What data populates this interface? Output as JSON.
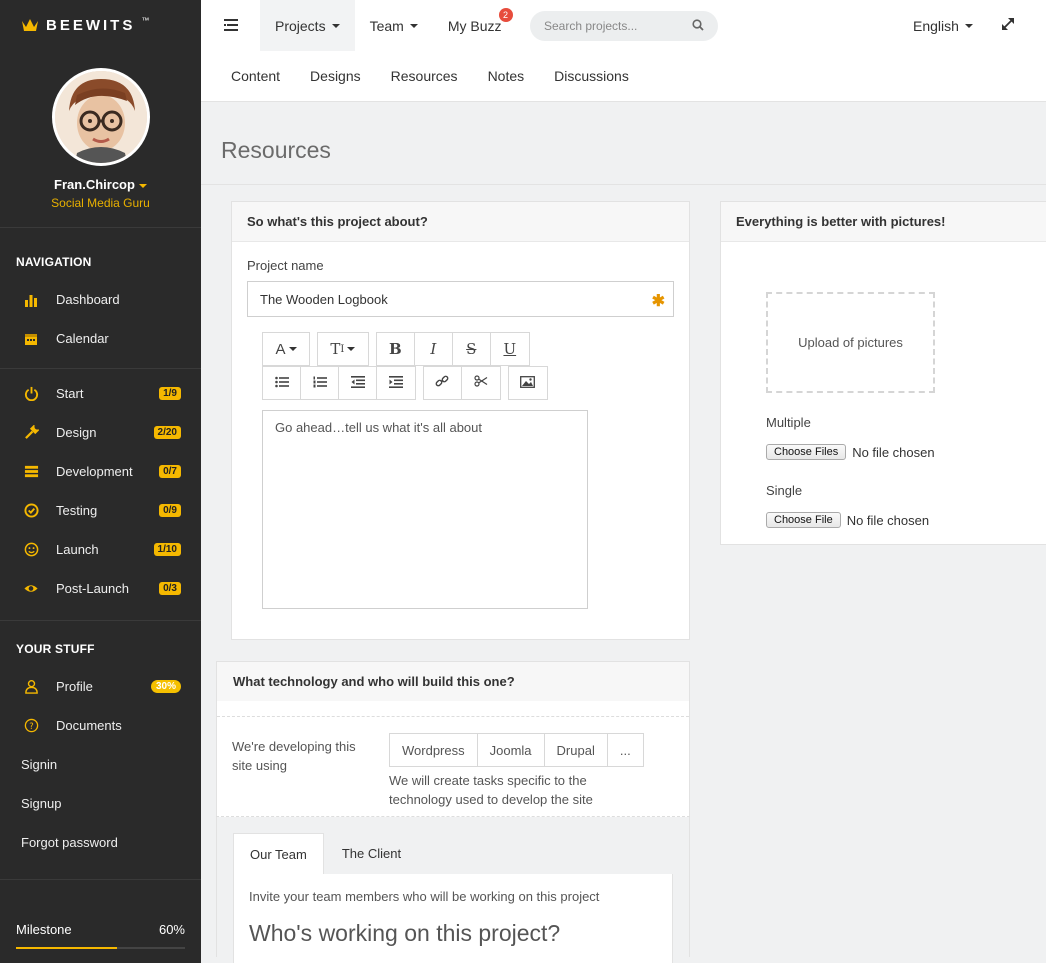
{
  "brand": {
    "name": "BEEWITS",
    "tm": "™",
    "accent": "#f5b800"
  },
  "user": {
    "name": "Fran.Chircop",
    "role": "Social Media Guru"
  },
  "nav": {
    "heading": "NAVIGATION",
    "items": [
      {
        "label": "Dashboard",
        "icon": "bar-chart-icon"
      },
      {
        "label": "Calendar",
        "icon": "calendar-icon"
      }
    ]
  },
  "phases": [
    {
      "label": "Start",
      "badge": "1/9",
      "icon": "power-icon"
    },
    {
      "label": "Design",
      "badge": "2/20",
      "icon": "wrench-icon"
    },
    {
      "label": "Development",
      "badge": "0/7",
      "icon": "server-icon"
    },
    {
      "label": "Testing",
      "badge": "0/9",
      "icon": "check-circle-icon"
    },
    {
      "label": "Launch",
      "badge": "1/10",
      "icon": "smile-icon"
    },
    {
      "label": "Post-Launch",
      "badge": "0/3",
      "icon": "eye-icon"
    }
  ],
  "your_stuff": {
    "heading": "YOUR STUFF",
    "items": [
      {
        "label": "Profile",
        "badge": "30%",
        "icon": "user-icon"
      },
      {
        "label": "Documents",
        "icon": "help-circle-icon"
      },
      {
        "label": "Signin"
      },
      {
        "label": "Signup"
      },
      {
        "label": "Forgot password"
      }
    ]
  },
  "milestone": {
    "label": "Milestone",
    "value": "60%",
    "progress": 0.6
  },
  "header": {
    "tabs": [
      {
        "label": "Projects",
        "dropdown": true,
        "active": true
      },
      {
        "label": "Team",
        "dropdown": true
      },
      {
        "label": "My Buzz",
        "notifications": "2"
      }
    ],
    "search_placeholder": "Search projects...",
    "language": "English",
    "subtabs": [
      "Content",
      "Designs",
      "Resources",
      "Notes",
      "Discussions"
    ]
  },
  "page": {
    "title": "Resources"
  },
  "project_panel": {
    "title": "So what's this project about?",
    "name_label": "Project name",
    "name_value": "The Wooden Logbook",
    "editor_text": "Go ahead…tell us what it's all about"
  },
  "pictures_panel": {
    "title": "Everything is better with pictures!",
    "upload_text": "Upload of pictures",
    "multiple_label": "Multiple",
    "multiple_button": "Choose Files",
    "multiple_status": "No file chosen",
    "single_label": "Single",
    "single_button": "Choose File",
    "single_status": "No file chosen"
  },
  "tech_panel": {
    "title": "What technology and who will build this one?",
    "developing_label": "We're developing this site using",
    "options": [
      "Wordpress",
      "Joomla",
      "Drupal",
      "..."
    ],
    "help_text": "We will create tasks specific to the technology used to develop the site",
    "tabs": [
      "Our Team",
      "The Client"
    ],
    "invite_text": "Invite your team members who will be working on this project",
    "who_heading": "Who's working on this project?"
  }
}
